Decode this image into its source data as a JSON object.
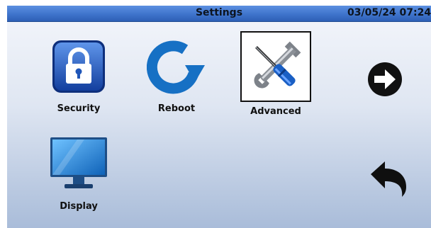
{
  "titlebar": {
    "title": "Settings",
    "datetime": "03/05/24 07:24"
  },
  "tiles": [
    {
      "label": "Security",
      "icon": "padlock-icon"
    },
    {
      "label": "Reboot",
      "icon": "reboot-arrow-icon"
    },
    {
      "label": "Advanced",
      "icon": "wrench-screwdriver-icon",
      "selected": true
    },
    {
      "label": "Display",
      "icon": "monitor-icon"
    }
  ],
  "nav": {
    "next_icon": "next-arrow-icon",
    "back_icon": "back-arrow-icon"
  },
  "colors": {
    "titlebar": "#3f74cc",
    "security_icon": "#1f56b8",
    "reboot_icon": "#1976cf",
    "display_icon": "#1a8ad8"
  }
}
